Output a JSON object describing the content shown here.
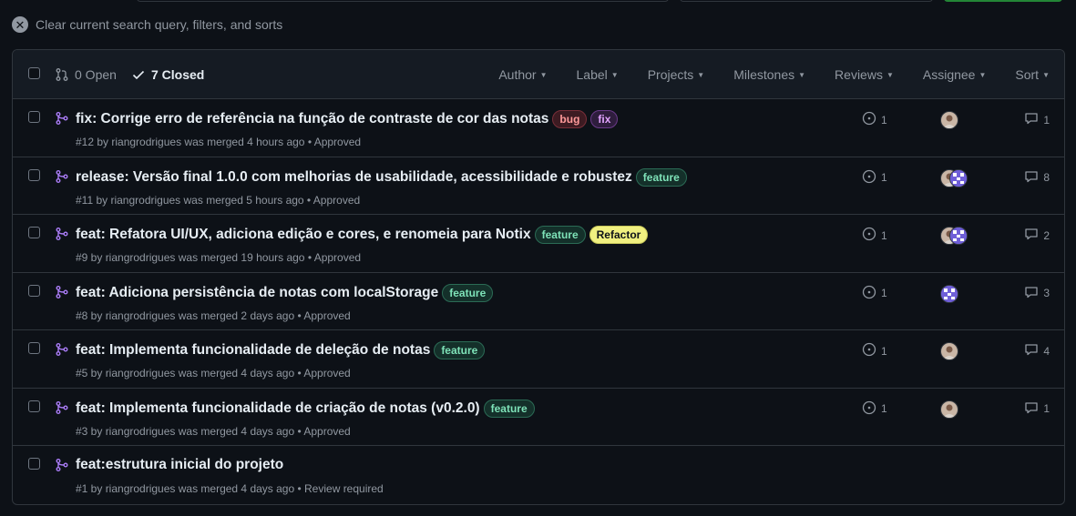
{
  "clear": {
    "label": "Clear current search query, filters, and sorts",
    "icon": "x-icon"
  },
  "header": {
    "open_label": "0 Open",
    "closed_label": "7 Closed",
    "filters": [
      "Author",
      "Label",
      "Projects",
      "Milestones",
      "Reviews",
      "Assignee",
      "Sort"
    ]
  },
  "colors": {
    "merged": "#ab7df8",
    "accent_green": "#238636"
  },
  "rows": [
    {
      "title": "fix: Corrige erro de referência na função de contraste de cor das notas",
      "labels": [
        {
          "text": "bug",
          "kind": "bug"
        },
        {
          "text": "fix",
          "kind": "fix"
        }
      ],
      "meta": "#12 by riangrodrigues was merged 4 hours ago • Approved",
      "issues": "1",
      "comments": "1",
      "avatars": [
        "person"
      ]
    },
    {
      "title": "release: Versão final 1.0.0 com melhorias de usabilidade, acessibilidade e robustez",
      "labels": [
        {
          "text": "feature",
          "kind": "feature"
        }
      ],
      "meta": "#11 by riangrodrigues was merged 5 hours ago • Approved",
      "issues": "1",
      "comments": "8",
      "avatars": [
        "person",
        "pattern"
      ]
    },
    {
      "title": "feat: Refatora UI/UX, adiciona edição e cores, e renomeia para Notix",
      "labels": [
        {
          "text": "feature",
          "kind": "feature"
        },
        {
          "text": "Refactor",
          "kind": "refactor"
        }
      ],
      "meta": "#9 by riangrodrigues was merged 19 hours ago • Approved",
      "issues": "1",
      "comments": "2",
      "avatars": [
        "person",
        "pattern"
      ]
    },
    {
      "title": "feat: Adiciona persistência de notas com localStorage",
      "labels": [
        {
          "text": "feature",
          "kind": "feature"
        }
      ],
      "meta": "#8 by riangrodrigues was merged 2 days ago • Approved",
      "issues": "1",
      "comments": "3",
      "avatars": [
        "pattern"
      ]
    },
    {
      "title": "feat: Implementa funcionalidade de deleção de notas",
      "labels": [
        {
          "text": "feature",
          "kind": "feature"
        }
      ],
      "meta": "#5 by riangrodrigues was merged 4 days ago • Approved",
      "issues": "1",
      "comments": "4",
      "avatars": [
        "person"
      ]
    },
    {
      "title": "feat: Implementa funcionalidade de criação de notas (v0.2.0)",
      "labels": [
        {
          "text": "feature",
          "kind": "feature"
        }
      ],
      "meta": "#3 by riangrodrigues was merged 4 days ago • Approved",
      "issues": "1",
      "comments": "1",
      "avatars": [
        "person"
      ]
    },
    {
      "title": "feat:estrutura inicial do projeto",
      "labels": [],
      "meta": "#1 by riangrodrigues was merged 4 days ago • Review required",
      "issues": "",
      "comments": "",
      "avatars": []
    }
  ]
}
